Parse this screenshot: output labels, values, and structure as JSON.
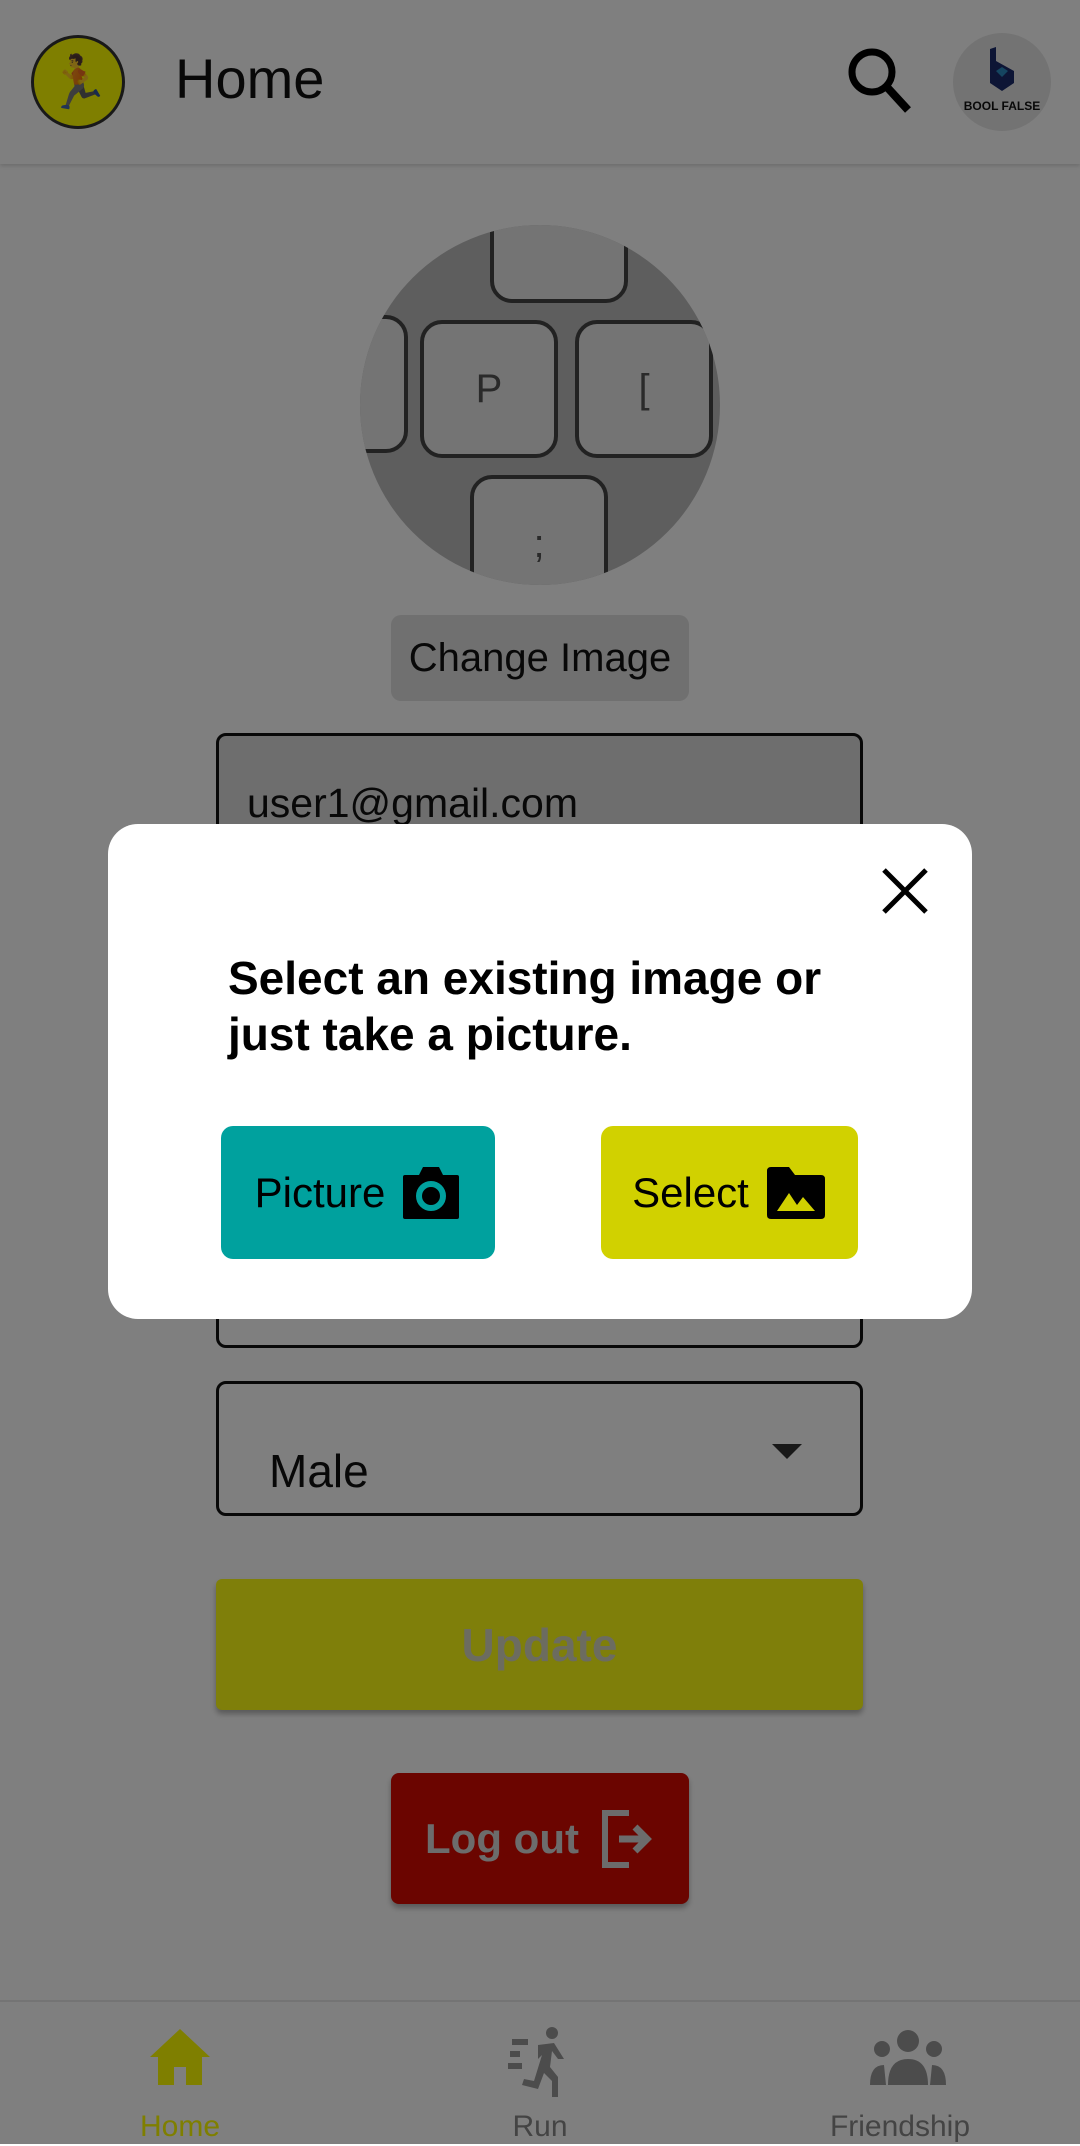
{
  "header": {
    "title": "Home",
    "avatar_text": "BOOL FALSE"
  },
  "profile": {
    "change_image_label": "Change Image"
  },
  "form": {
    "email": "user1@gmail.com",
    "gender": "Male",
    "update_label": "Update",
    "logout_label": "Log out"
  },
  "bottom_nav": {
    "items": [
      {
        "label": "Home",
        "active": true
      },
      {
        "label": "Run"
      },
      {
        "label": "Friendship"
      }
    ]
  },
  "dialog": {
    "message": "Select an existing image or just take a picture.",
    "picture_label": "Picture",
    "select_label": "Select"
  },
  "colors": {
    "accent": "#fefe14",
    "picture": "#00a19e",
    "select": "#d1d100",
    "logout": "#d60a00",
    "nav_active": "#fefe00"
  }
}
